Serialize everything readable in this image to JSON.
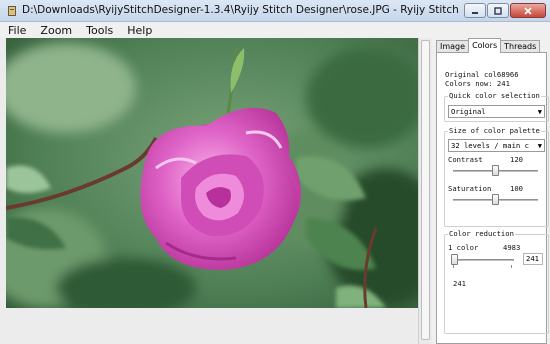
{
  "window": {
    "title": "D:\\Downloads\\RyijyStitchDesigner-1.3.4\\Ryijy Stitch Designer\\rose.JPG - Ryijy Stitch Designer"
  },
  "menu": [
    "File",
    "Zoom",
    "Tools",
    "Help"
  ],
  "tabs": [
    {
      "label": "Image",
      "active": false
    },
    {
      "label": "Colors",
      "active": true
    },
    {
      "label": "Threads",
      "active": false
    }
  ],
  "colors_panel": {
    "original_colors": "Original col68966",
    "colors_now": "Colors now: 241",
    "quick_color": {
      "label": "Quick color selection",
      "value": "Original"
    },
    "palette_size": {
      "label": "Size of color palette",
      "value": "32 levels / main c"
    },
    "contrast": {
      "label": "Contrast",
      "value": "120",
      "level": 0.5
    },
    "saturation": {
      "label": "Saturation",
      "value": "100",
      "level": 0.5
    },
    "reduction": {
      "label": "Color reduction",
      "min_label": "1 color",
      "max_value": "4983",
      "current_box": "241",
      "current_text": "241",
      "level": 0.05
    }
  },
  "colors": {
    "accent": "#e05fc6",
    "leaf_dark": "#2f5a33",
    "bg_green": "#5c8b5e"
  },
  "icons": {
    "app": "app-icon",
    "minimize": "minimize-icon",
    "maximize": "maximize-icon",
    "close": "close-icon"
  }
}
